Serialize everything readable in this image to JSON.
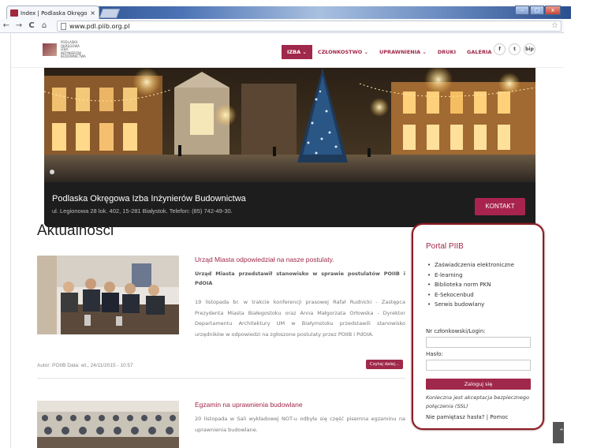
{
  "browser": {
    "tab_title": "Index | Podlaska Okręgo",
    "tab_close": "×",
    "url": "www.pdl.piib.org.pl",
    "star": "☆",
    "back": "←",
    "forward": "→",
    "reload": "C",
    "home": "⌂",
    "minimize": "–",
    "maximize": "□",
    "close": "x"
  },
  "header": {
    "logo_text": "PODLASKA OKRĘGOWA IZBA INŻYNIERÓW BUDOWNICTWA",
    "nav": [
      {
        "label": "IZBA ⌄"
      },
      {
        "label": "CZŁONKOSTWO ⌄"
      },
      {
        "label": "UPRAWNIENIA ⌄"
      },
      {
        "label": "DRUKI"
      },
      {
        "label": "GALERIA"
      }
    ],
    "social": [
      "f",
      "t",
      "bip"
    ]
  },
  "hero": {
    "title": "Podlaska Okręgowa Izba Inżynierów Budownictwa",
    "address": "ul. Legionowa 28 lok. 402, 15-281 Białystok. Telefon: (85) 742-49-30.",
    "contact_label": "KONTAKT"
  },
  "news": {
    "heading": "Aktualności",
    "items": [
      {
        "title": "Urząd Miasta odpowiedział na nasze postulaty.",
        "subtitle": "Urząd Miasta przedstawił stanowisko w sprawie postulatów POIIB i PdOIA",
        "text": "19 listopada br. w trakcie konferencji prasowej Rafał Rudnicki - Zastępca Prezydenta Miasta Białegostoku oraz Anna Małgorzata Orłowska - Dyrektor Departamentu Architektury UM w Białymstoku przedstawili stanowisko urzędników w odpowiedzi na zgłoszone postulaty przez POIIB i PdOIA.",
        "meta": "Autor: POIIB Data: wt., 24/11/2015 - 10:57",
        "read_more": "Czytaj dalej..."
      },
      {
        "title": "Egzamin na uprawnienia budowlane",
        "text": "20 listopada w Sali wykładowej NOT-u odbyła się część pisemna egzaminu na uprawnienia budowlane."
      }
    ]
  },
  "portal": {
    "title": "Portal PIIB",
    "items": [
      "Zaświadczenia elektroniczne",
      "E-learning",
      "Biblioteka norm PKN",
      "E-Sekocenbud",
      "Serwis budowlany"
    ],
    "login_label": "Nr członkowski/Login:",
    "login_value": "",
    "password_label": "Hasło:",
    "password_value": "",
    "login_button": "Zaloguj się",
    "ssl_note": "Konieczna jest akceptacja bezpiecznego połączenia (SSL)",
    "links": "Nie pamiętasz hasła? | Pomoc"
  },
  "scroll_top": "⌃"
}
